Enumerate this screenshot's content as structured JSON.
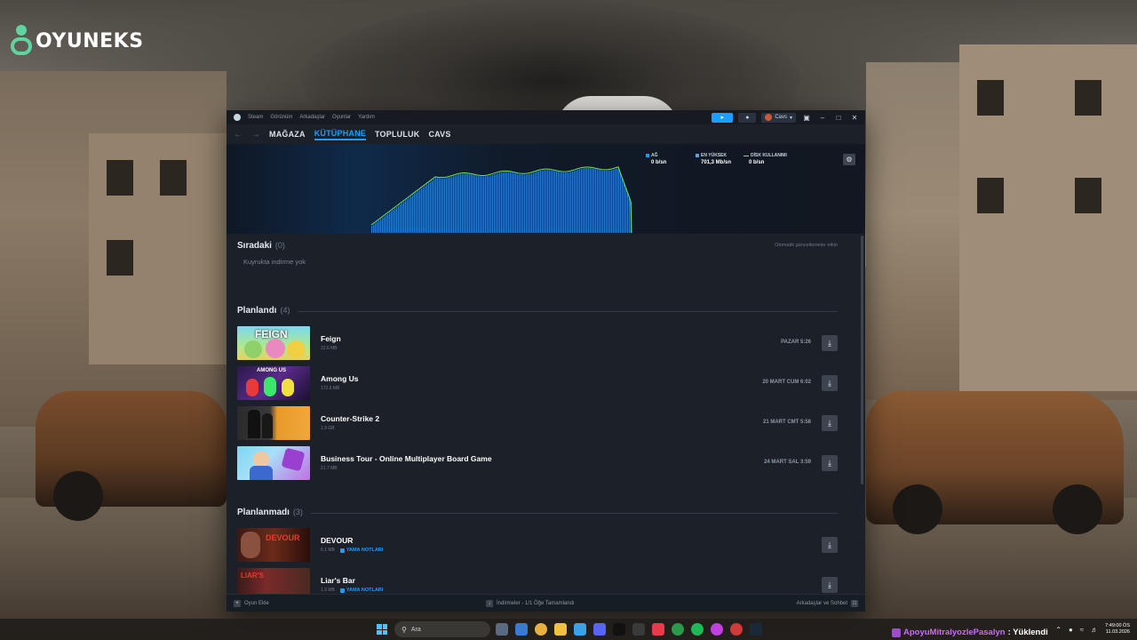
{
  "brand": {
    "logo_text": "OYUNEKS"
  },
  "steam": {
    "menu": [
      "Steam",
      "Görünüm",
      "Arkadaşlar",
      "Oyunlar",
      "Yardım"
    ],
    "user_name": "Cavs",
    "nav": {
      "store": "MAĞAZA",
      "library": "KÜTÜPHANE",
      "community": "TOPLULUK",
      "profile": "CAVS"
    },
    "stats": {
      "network_label": "AĞ",
      "network_value": "0 b/sn",
      "peak_label": "EN YÜKSEK",
      "peak_value": "701,3 Mb/sn",
      "disk_label": "DİSK KULLANIMI",
      "disk_value": "0 b/sn"
    },
    "queue": {
      "title": "Sıradaki",
      "count": "(0)",
      "auto_updates": "Otomatik güncellemeler etkin",
      "empty_message": "Kuyrukta indirme yok"
    },
    "scheduled": {
      "title": "Planlandı",
      "count": "(4)",
      "games": [
        {
          "name": "Feign",
          "size": "22.6 MB",
          "time": "PAZAR 5:26",
          "thumb_text": "FEIGN"
        },
        {
          "name": "Among Us",
          "size": "172.6 MB",
          "time": "20 MART CUM 6:02",
          "thumb_text": "AMONG US"
        },
        {
          "name": "Counter-Strike 2",
          "size": "1.9 GB",
          "time": "21 MART CMT 5:58",
          "thumb_text": ""
        },
        {
          "name": "Business Tour - Online Multiplayer Board Game",
          "size": "21.7 MB",
          "time": "24 MART SAL 3:59",
          "thumb_text": ""
        }
      ]
    },
    "unscheduled": {
      "title": "Planlanmadı",
      "count": "(3)",
      "games": [
        {
          "name": "DEVOUR",
          "size": "6.1 MB",
          "patch": "YAMA NOTLARI",
          "thumb_text": "DEVOUR"
        },
        {
          "name": "Liar's Bar",
          "size": "1.9 MB",
          "patch": "YAMA NOTLARI",
          "thumb_text": "LIAR'S"
        }
      ]
    },
    "footer": {
      "add_game": "Oyun Ekle",
      "downloads": "İndirmeler - 1/1 Öğe Tamamlandı",
      "friends_chat": "Arkadaşlar ve Sohbet"
    }
  },
  "taskbar": {
    "search_placeholder": "Ara",
    "stream_user": "ApoyuMitralyozlePasalyn",
    "stream_status": ": Yüklendi",
    "time": "7:49:00 ÖS",
    "date": "11.03.2026"
  },
  "colors": {
    "accent": "#1a9fff",
    "graph_line": "#7ee05a",
    "window_bg": "#1b2029"
  }
}
